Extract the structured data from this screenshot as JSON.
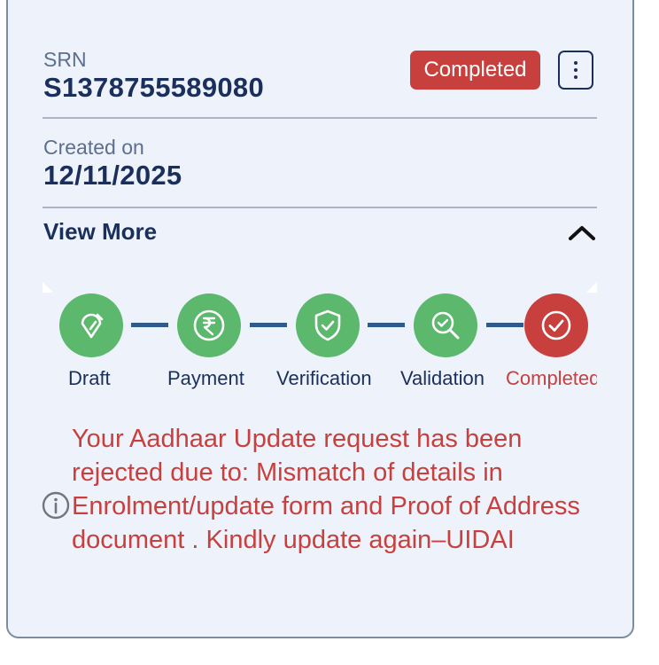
{
  "request": {
    "srn_label": "SRN",
    "srn_value": "S1378755589080",
    "status_badge": "Completed",
    "created_label": "Created on",
    "created_value": "12/11/2025",
    "view_more_label": "View More"
  },
  "steps": [
    {
      "label": "Draft",
      "icon": "edit-icon",
      "state": "done"
    },
    {
      "label": "Payment",
      "icon": "rupee-icon",
      "state": "done"
    },
    {
      "label": "Verification",
      "icon": "shield-check-icon",
      "state": "done"
    },
    {
      "label": "Validation",
      "icon": "search-check-icon",
      "state": "done"
    },
    {
      "label": "Completed",
      "icon": "check-circle-icon",
      "state": "completed"
    }
  ],
  "message": {
    "text": "Your Aadhaar Update request has been rejected due to: Mismatch of details in Enrolment/update form and Proof of Address document . Kindly update again–UIDAI",
    "icon": "info-icon"
  },
  "colors": {
    "card_bg": "#eef3fb",
    "primary_text": "#1b2f5c",
    "success": "#5cb86c",
    "danger": "#c8403e",
    "connector": "#2f5a8c"
  }
}
